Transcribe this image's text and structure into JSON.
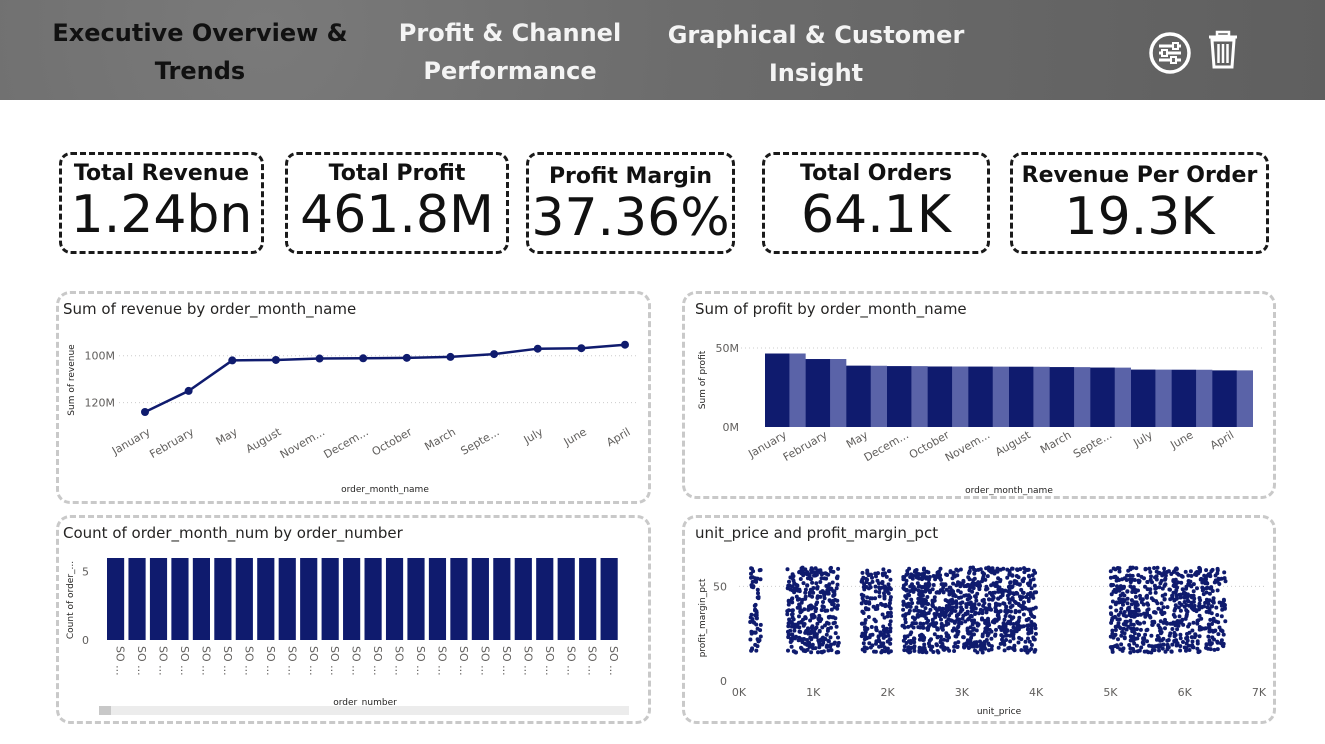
{
  "nav": {
    "tab1": {
      "line1": "Executive Overview &",
      "line2": "Trends"
    },
    "tab2": {
      "line1": "Profit & Channel",
      "line2": "Performance"
    },
    "tab3": {
      "line1": "Graphical & Customer",
      "line2": "Insight"
    }
  },
  "toolbar": {
    "filter_icon": "sliders-icon",
    "delete_icon": "trash-icon"
  },
  "kpis": [
    {
      "label": "Total Revenue",
      "value": "1.24bn"
    },
    {
      "label": "Total Profit",
      "value": "461.8M"
    },
    {
      "label": "Profit Margin",
      "value": "37.36%"
    },
    {
      "label": "Total Orders",
      "value": "64.1K"
    },
    {
      "label": "Revenue Per Order",
      "value": "19.3K"
    }
  ],
  "colors": {
    "primary": "#0f1b6e",
    "secondary": "#5a63a8",
    "grid": "#cccccc"
  },
  "chart_data": [
    {
      "type": "line",
      "title": "Sum of revenue by order_month_name",
      "xlabel": "order_month_name",
      "ylabel": "Sum of revenue",
      "y_ticks": [
        "100M",
        "120M"
      ],
      "categories": [
        "January",
        "February",
        "May",
        "August",
        "Novem...",
        "Decem...",
        "October",
        "March",
        "Septe...",
        "July",
        "June",
        "April"
      ],
      "values": [
        124,
        115,
        102,
        101.8,
        101.2,
        101.1,
        100.9,
        100.5,
        99.3,
        97,
        96.8,
        95.3
      ],
      "ylim": [
        95,
        124
      ]
    },
    {
      "type": "bar",
      "title": "Sum of profit by order_month_name",
      "xlabel": "order_month_name",
      "ylabel": "Sum of profit",
      "y_ticks": [
        "50M",
        "0M"
      ],
      "categories": [
        "January",
        "February",
        "May",
        "Decem...",
        "October",
        "Novem...",
        "August",
        "March",
        "Septe...",
        "July",
        "June",
        "April"
      ],
      "values": [
        46.5,
        43,
        38.8,
        38.5,
        38.3,
        38.2,
        38.1,
        37.9,
        37.6,
        36.3,
        36.2,
        35.8
      ],
      "ylim": [
        0,
        50
      ]
    },
    {
      "type": "bar",
      "title": "Count of order_month_num by order_number",
      "xlabel": "order_number",
      "ylabel": "Count of order_...",
      "y_ticks": [
        "5",
        "0"
      ],
      "category_label": "SO ...",
      "bar_count": 24,
      "values": [
        6,
        6,
        6,
        6,
        6,
        6,
        6,
        6,
        6,
        6,
        6,
        6,
        6,
        6,
        6,
        6,
        6,
        6,
        6,
        6,
        6,
        6,
        6,
        6
      ],
      "ylim": [
        0,
        6
      ]
    },
    {
      "type": "scatter",
      "title": "unit_price and profit_margin_pct",
      "xlabel": "unit_price",
      "ylabel": "profit_margin_pct",
      "x_ticks": [
        "0K",
        "1K",
        "2K",
        "3K",
        "4K",
        "5K",
        "6K",
        "7K"
      ],
      "y_ticks": [
        "50",
        "0"
      ],
      "xlim": [
        0,
        7000
      ],
      "ylim": [
        0,
        65
      ],
      "clusters": [
        {
          "x_range": [
            150,
            300
          ],
          "y_range": [
            15,
            60
          ],
          "count": 60
        },
        {
          "x_range": [
            650,
            1350
          ],
          "y_range": [
            15,
            60
          ],
          "count": 350
        },
        {
          "x_range": [
            1650,
            2050
          ],
          "y_range": [
            15,
            60
          ],
          "count": 180
        },
        {
          "x_range": [
            2200,
            4000
          ],
          "y_range": [
            15,
            60
          ],
          "count": 900
        },
        {
          "x_range": [
            5000,
            6550
          ],
          "y_range": [
            15,
            60
          ],
          "count": 650
        }
      ]
    }
  ]
}
